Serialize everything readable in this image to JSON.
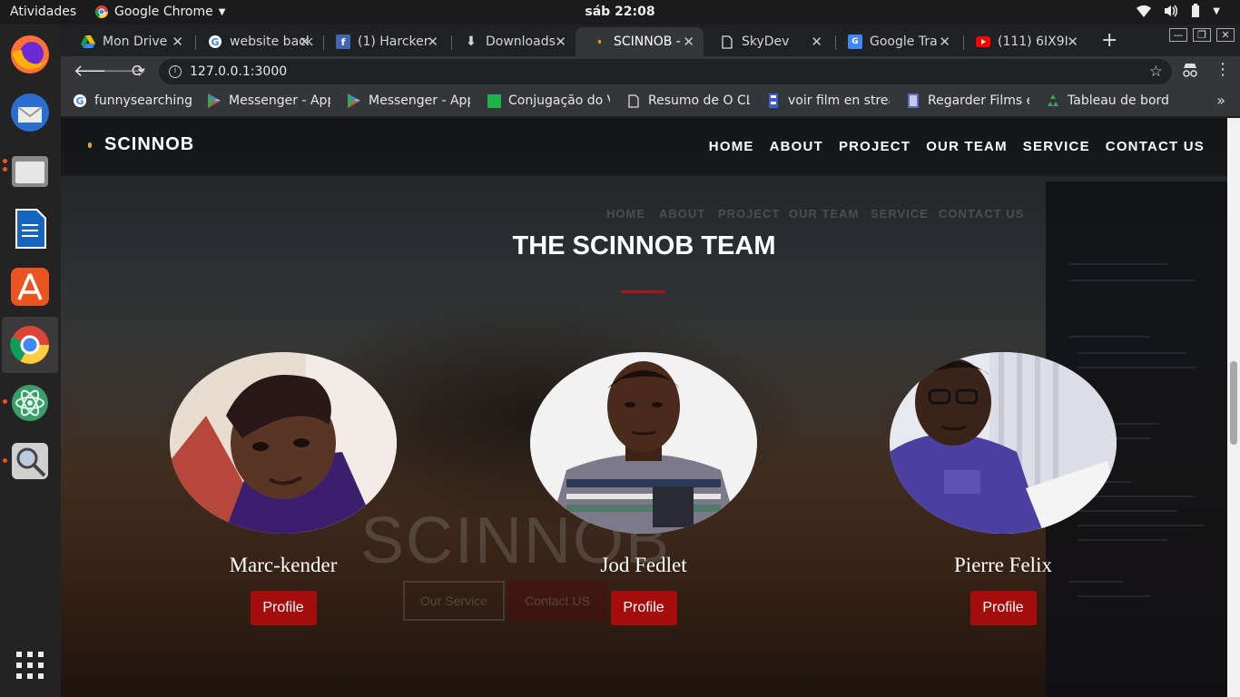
{
  "os": {
    "activities": "Atividades",
    "app_menu": "Google Chrome",
    "clock": "sáb 22:08"
  },
  "dock": [
    "firefox-icon",
    "thunderbird-icon",
    "files-icon",
    "writer-icon",
    "software-icon",
    "chrome-icon",
    "atom-icon",
    "screenshot-icon",
    "app-grid-icon"
  ],
  "browser": {
    "tabs": [
      {
        "title": "Mon Drive",
        "icon": "google-drive-icon"
      },
      {
        "title": "website back",
        "icon": "google-icon"
      },
      {
        "title": "(1) Harcker",
        "icon": "facebook-icon"
      },
      {
        "title": "Downloads",
        "icon": "download-icon"
      },
      {
        "title": "SCINNOB - ",
        "icon": "site-icon",
        "active": true
      },
      {
        "title": "SkyDev",
        "icon": "page-icon"
      },
      {
        "title": "Google Tra",
        "icon": "translate-icon"
      },
      {
        "title": "(111) 6IX9I",
        "icon": "youtube-icon"
      }
    ],
    "url": "127.0.0.1:3000",
    "bookmarks": [
      {
        "label": "funnysearching",
        "icon": "google-icon"
      },
      {
        "label": "Messenger - App",
        "icon": "play-icon"
      },
      {
        "label": "Messenger - App",
        "icon": "play-icon"
      },
      {
        "label": "Conjugação do V",
        "icon": "green-square-icon"
      },
      {
        "label": "Resumo de O CL",
        "icon": "page-icon"
      },
      {
        "label": "voir film en strea",
        "icon": "film-icon"
      },
      {
        "label": "Regarder Films e",
        "icon": "film-icon"
      },
      {
        "label": "Tableau de bord",
        "icon": "recycle-icon"
      }
    ]
  },
  "site": {
    "logo": "SCINNOB",
    "nav": [
      "HOME",
      "ABOUT",
      "PROJECT",
      "OUR TEAM",
      "SERVICE",
      "CONTACT US"
    ],
    "section_title": "THE SCINNOB TEAM",
    "members": [
      {
        "name": "Marc-kender",
        "button": "Profile"
      },
      {
        "name": "Jod Fedlet",
        "button": "Profile"
      },
      {
        "name": "Pierre Felix",
        "button": "Profile"
      }
    ],
    "background_ghost": {
      "nav": [
        "HOME",
        "ABOUT",
        "PROJECT",
        "OUR TEAM",
        "SERVICE",
        "CONTACT US"
      ],
      "logo": "SCINNOB",
      "buttons": [
        "Our Service",
        "Contact US"
      ]
    }
  },
  "colors": {
    "accent": "#a50d0d",
    "rule": "#b0121a"
  }
}
